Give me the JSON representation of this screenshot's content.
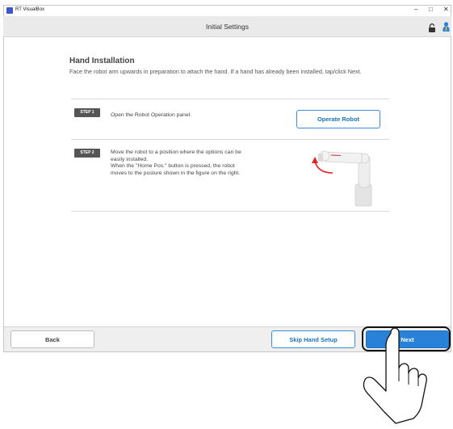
{
  "window": {
    "app_title": "RT VisualBox",
    "controls": {
      "minimize": "–",
      "maximize": "□",
      "close": "✕"
    }
  },
  "header": {
    "title": "Initial Settings",
    "icons": [
      "lock-icon",
      "user-icon"
    ]
  },
  "main": {
    "title": "Hand Installation",
    "description": "Face the robot arm upwards in preparation to attach the hand. If a hand has already been installed, tap/click Next.",
    "steps": [
      {
        "badge": "STEP 1",
        "text": "Open the Robot Operation panel.",
        "button_label": "Operate Robot"
      },
      {
        "badge": "STEP 2",
        "text_lines": [
          "Move the robot to a position where the options can be",
          "easily installed.",
          "When the \"Home Pos.\" button is pressed, the robot",
          "moves to the posture shown in the figure on the right."
        ],
        "image": "robot-arm-icon"
      }
    ]
  },
  "footer": {
    "back_label": "Back",
    "skip_label": "Skip Hand Setup",
    "next_label": "Next"
  },
  "colors": {
    "accent": "#2a82d8",
    "accent_text": "#1a73c0",
    "badge_bg": "#555555",
    "header_bg": "#eaeaea"
  }
}
